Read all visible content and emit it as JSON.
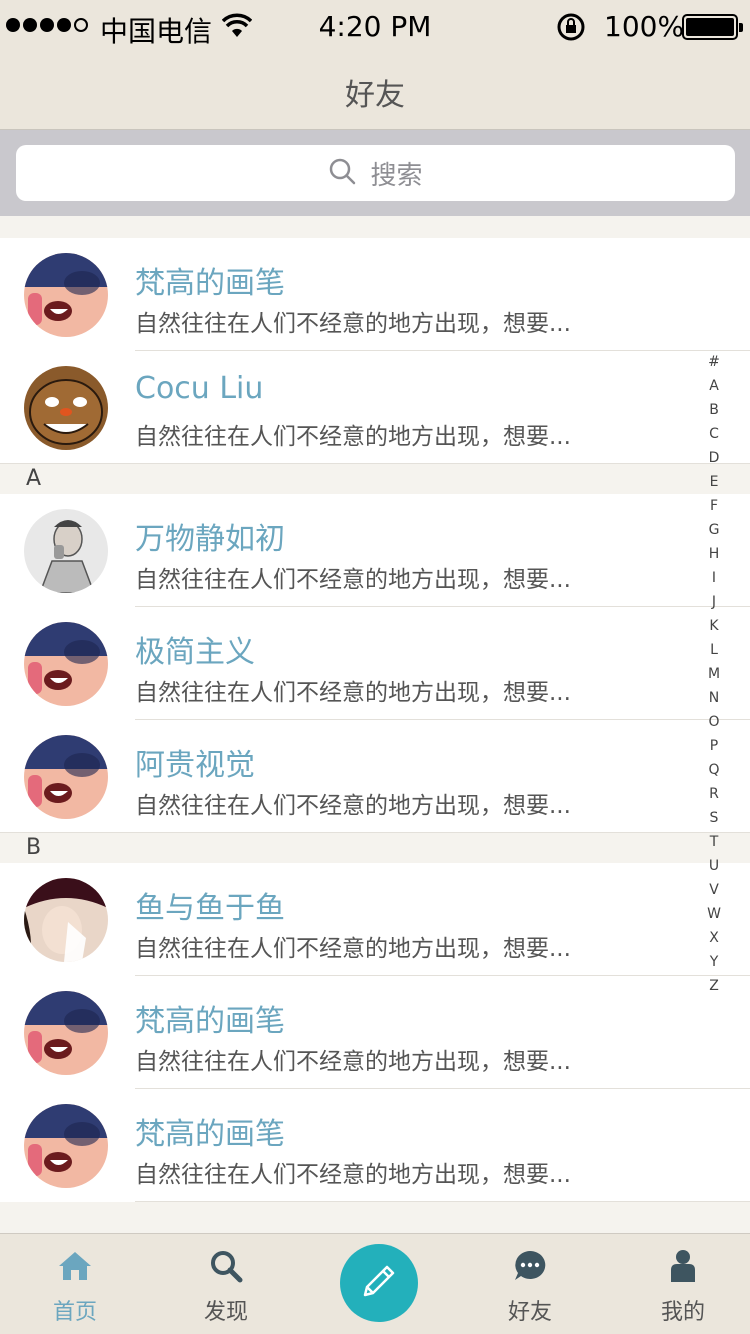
{
  "status_bar": {
    "carrier": "中国电信",
    "time": "4:20 PM",
    "battery": "100%"
  },
  "nav": {
    "title": "好友"
  },
  "search": {
    "placeholder": "搜索"
  },
  "sections": [
    {
      "letter": "",
      "contacts": [
        {
          "name": "梵高的画笔",
          "message": "自然往往在人们不经意的地方出现，想要...",
          "avatar": "girl-glasses"
        },
        {
          "name": "Cocu Liu",
          "message": "自然往往在人们不经意的地方出现，想要...",
          "avatar": "cartoon-face"
        }
      ]
    },
    {
      "letter": "A",
      "contacts": [
        {
          "name": "万物静如初",
          "message": "自然往往在人们不经意的地方出现，想要...",
          "avatar": "man-sketch"
        },
        {
          "name": "极简主义",
          "message": "自然往往在人们不经意的地方出现，想要...",
          "avatar": "girl-glasses"
        },
        {
          "name": "阿贵视觉",
          "message": "自然往往在人们不经意的地方出现，想要...",
          "avatar": "girl-glasses"
        }
      ]
    },
    {
      "letter": "B",
      "contacts": [
        {
          "name": "鱼与鱼于鱼",
          "message": "自然往往在人们不经意的地方出现，想要...",
          "avatar": "girl-hat"
        },
        {
          "name": "梵高的画笔",
          "message": "自然往往在人们不经意的地方出现，想要...",
          "avatar": "girl-glasses"
        },
        {
          "name": "梵高的画笔",
          "message": "自然往往在人们不经意的地方出现，想要...",
          "avatar": "girl-glasses"
        }
      ]
    }
  ],
  "index_letters": [
    "#",
    "A",
    "B",
    "C",
    "D",
    "E",
    "F",
    "G",
    "H",
    "I",
    "J",
    "K",
    "L",
    "M",
    "N",
    "O",
    "P",
    "Q",
    "R",
    "S",
    "T",
    "U",
    "V",
    "W",
    "X",
    "Y",
    "Z"
  ],
  "tabs": [
    {
      "label": "首页",
      "icon": "home-icon",
      "active": true
    },
    {
      "label": "发现",
      "icon": "search-icon",
      "active": false
    },
    {
      "label": "",
      "icon": "pencil-icon",
      "active": false
    },
    {
      "label": "好友",
      "icon": "chat-bubble-icon",
      "active": false
    },
    {
      "label": "我的",
      "icon": "person-icon",
      "active": false
    }
  ],
  "colors": {
    "accent": "#6ba6bf",
    "compose": "#23b0bb",
    "bar_bg": "#ebe6dc"
  }
}
